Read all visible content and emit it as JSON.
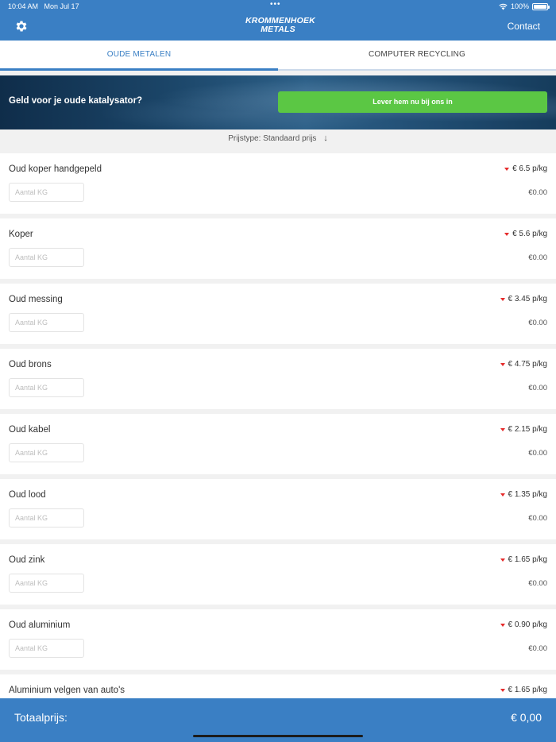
{
  "status": {
    "time": "10:04 AM",
    "date": "Mon Jul 17",
    "multitask_dots": "•••",
    "battery_text": "100%",
    "battery_level": 1.0,
    "wifi_icon": "wifi-icon"
  },
  "header": {
    "settings_icon": "gear-icon",
    "logo_line1": "KROMMENHOEK",
    "logo_line2": "METALS",
    "contact": "Contact"
  },
  "tabs": [
    {
      "label": "OUDE METALEN",
      "active": true
    },
    {
      "label": "COMPUTER RECYCLING",
      "active": false
    }
  ],
  "banner": {
    "text": "Geld voor je oude katalysator?",
    "button": "Lever hem nu bij ons in"
  },
  "price_type": {
    "label": "Prijstype: Standaard prijs",
    "icon": "arrow-down-icon"
  },
  "input_placeholder": "Aantal KG",
  "items": [
    {
      "name": "Oud koper handgepeld",
      "price": "€ 6.5 p/kg",
      "total": "€0.00"
    },
    {
      "name": "Koper",
      "price": "€ 5.6 p/kg",
      "total": "€0.00"
    },
    {
      "name": "Oud messing",
      "price": "€ 3.45 p/kg",
      "total": "€0.00"
    },
    {
      "name": "Oud brons",
      "price": "€ 4.75 p/kg",
      "total": "€0.00"
    },
    {
      "name": "Oud kabel",
      "price": "€ 2.15 p/kg",
      "total": "€0.00"
    },
    {
      "name": "Oud lood",
      "price": "€ 1.35 p/kg",
      "total": "€0.00"
    },
    {
      "name": "Oud zink",
      "price": "€ 1.65 p/kg",
      "total": "€0.00"
    },
    {
      "name": "Oud aluminium",
      "price": "€ 0.90 p/kg",
      "total": "€0.00"
    },
    {
      "name": "Aluminium velgen van auto's",
      "price": "€ 1.65 p/kg",
      "total": ""
    }
  ],
  "footer": {
    "label": "Totaalprijs:",
    "value": "€ 0,00"
  },
  "colors": {
    "brand_blue": "#3a7fc4",
    "cta_green": "#5bc744",
    "price_down_red": "#e52b2b"
  }
}
